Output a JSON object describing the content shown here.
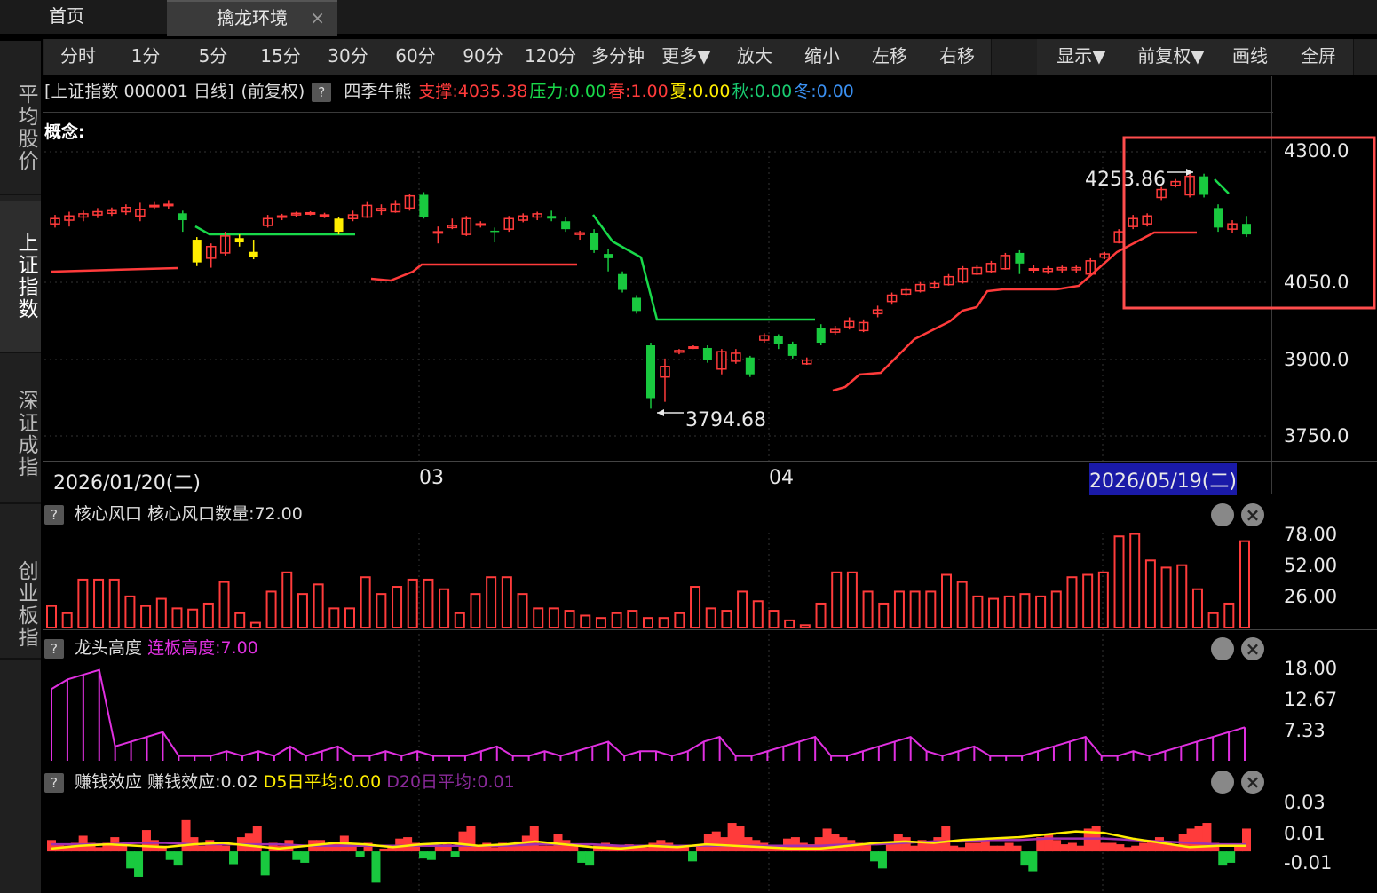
{
  "tabs": {
    "home": "首页",
    "active": "擒龙环境",
    "close": "×"
  },
  "leftnav": [
    "平均股价",
    "上证指数",
    "深证成指",
    "创业板指"
  ],
  "toolbar": [
    "分时",
    "1分",
    "5分",
    "15分",
    "30分",
    "60分",
    "90分",
    "120分",
    "多分钟",
    "更多▼",
    "放大",
    "缩小",
    "左移",
    "右移",
    "显示▼",
    "前复权▼",
    "画线",
    "全屏"
  ],
  "info": {
    "title": "[上证指数 000001 日线]",
    "adjust": "(前复权)",
    "help": "?",
    "indicator": "四季牛熊",
    "support": "支撑:4035.38",
    "pressure": "压力:0.00",
    "spring": "春:1.00",
    "summer": "夏:0.00",
    "autumn": "秋:0.00",
    "winter": "冬:0.00",
    "concept": "概念:"
  },
  "colors": {
    "up": "#ff3b3b",
    "down": "#19c93f",
    "yellow": "#ffee00",
    "magenta": "#e030e0",
    "purple": "#a030b0",
    "highlight": "#ff4d4d"
  },
  "chart_data": [
    {
      "type": "candlestick",
      "title": "上证指数 000001 日线",
      "x_labels": [
        "2026/01/20(二)",
        "03",
        "04",
        "2026/05/19(二)"
      ],
      "y_ticks": [
        "4300.0",
        "4050.0",
        "3900.0",
        "3750.0"
      ],
      "ylim": [
        3730,
        4310
      ],
      "annotations": {
        "high": "4253.86",
        "low": "3794.68"
      },
      "candles": [
        {
          "o": 4155,
          "c": 4165,
          "h": 4172,
          "l": 4148
        },
        {
          "o": 4162,
          "c": 4170,
          "h": 4178,
          "l": 4150
        },
        {
          "o": 4168,
          "c": 4174,
          "h": 4180,
          "l": 4160
        },
        {
          "o": 4172,
          "c": 4178,
          "h": 4185,
          "l": 4166
        },
        {
          "o": 4175,
          "c": 4180,
          "h": 4186,
          "l": 4170
        },
        {
          "o": 4178,
          "c": 4186,
          "h": 4192,
          "l": 4172
        },
        {
          "o": 4170,
          "c": 4182,
          "h": 4195,
          "l": 4160
        },
        {
          "o": 4188,
          "c": 4190,
          "h": 4198,
          "l": 4182
        },
        {
          "o": 4190,
          "c": 4192,
          "h": 4200,
          "l": 4184
        },
        {
          "o": 4175,
          "c": 4162,
          "h": 4180,
          "l": 4140
        },
        {
          "o": 4125,
          "c": 4082,
          "h": 4130,
          "l": 4075
        },
        {
          "o": 4090,
          "c": 4112,
          "h": 4118,
          "l": 4072
        },
        {
          "o": 4100,
          "c": 4132,
          "h": 4140,
          "l": 4095
        },
        {
          "o": 4128,
          "c": 4120,
          "h": 4135,
          "l": 4112
        },
        {
          "o": 4102,
          "c": 4092,
          "h": 4125,
          "l": 4088
        },
        {
          "o": 4152,
          "c": 4165,
          "h": 4172,
          "l": 4148
        },
        {
          "o": 4168,
          "c": 4170,
          "h": 4174,
          "l": 4162
        },
        {
          "o": 4172,
          "c": 4175,
          "h": 4178,
          "l": 4168
        },
        {
          "o": 4175,
          "c": 4176,
          "h": 4179,
          "l": 4171
        },
        {
          "o": 4170,
          "c": 4172,
          "h": 4176,
          "l": 4166
        },
        {
          "o": 4165,
          "c": 4140,
          "h": 4168,
          "l": 4135
        },
        {
          "o": 4165,
          "c": 4172,
          "h": 4180,
          "l": 4160
        },
        {
          "o": 4168,
          "c": 4190,
          "h": 4198,
          "l": 4166
        },
        {
          "o": 4180,
          "c": 4184,
          "h": 4192,
          "l": 4172
        },
        {
          "o": 4178,
          "c": 4192,
          "h": 4200,
          "l": 4176
        },
        {
          "o": 4185,
          "c": 4208,
          "h": 4212,
          "l": 4180
        },
        {
          "o": 4210,
          "c": 4168,
          "h": 4215,
          "l": 4165
        },
        {
          "o": 4138,
          "c": 4140,
          "h": 4150,
          "l": 4118
        },
        {
          "o": 4148,
          "c": 4152,
          "h": 4165,
          "l": 4145
        },
        {
          "o": 4135,
          "c": 4165,
          "h": 4170,
          "l": 4132
        },
        {
          "o": 4155,
          "c": 4155,
          "h": 4160,
          "l": 4148
        },
        {
          "o": 4142,
          "c": 4140,
          "h": 4148,
          "l": 4120
        },
        {
          "o": 4145,
          "c": 4165,
          "h": 4170,
          "l": 4140
        },
        {
          "o": 4162,
          "c": 4170,
          "h": 4175,
          "l": 4158
        },
        {
          "o": 4168,
          "c": 4174,
          "h": 4178,
          "l": 4162
        },
        {
          "o": 4170,
          "c": 4165,
          "h": 4180,
          "l": 4160
        },
        {
          "o": 4160,
          "c": 4145,
          "h": 4168,
          "l": 4140
        },
        {
          "o": 4135,
          "c": 4138,
          "h": 4142,
          "l": 4125
        },
        {
          "o": 4138,
          "c": 4105,
          "h": 4145,
          "l": 4100
        },
        {
          "o": 4098,
          "c": 4090,
          "h": 4108,
          "l": 4065
        },
        {
          "o": 4060,
          "c": 4030,
          "h": 4065,
          "l": 4025
        },
        {
          "o": 4015,
          "c": 3990,
          "h": 4020,
          "l": 3985
        },
        {
          "o": 3925,
          "c": 3825,
          "h": 3930,
          "l": 3805
        },
        {
          "o": 3865,
          "c": 3885,
          "h": 3900,
          "l": 3818
        },
        {
          "o": 3912,
          "c": 3915,
          "h": 3918,
          "l": 3908
        },
        {
          "o": 3922,
          "c": 3922,
          "h": 3925,
          "l": 3918
        },
        {
          "o": 3920,
          "c": 3897,
          "h": 3925,
          "l": 3892
        },
        {
          "o": 3880,
          "c": 3913,
          "h": 3918,
          "l": 3870
        },
        {
          "o": 3895,
          "c": 3910,
          "h": 3918,
          "l": 3890
        },
        {
          "o": 3902,
          "c": 3870,
          "h": 3905,
          "l": 3865
        },
        {
          "o": 3935,
          "c": 3943,
          "h": 3948,
          "l": 3930
        },
        {
          "o": 3942,
          "c": 3928,
          "h": 3946,
          "l": 3918
        },
        {
          "o": 3928,
          "c": 3905,
          "h": 3932,
          "l": 3900
        },
        {
          "o": 3890,
          "c": 3897,
          "h": 3902,
          "l": 3888
        },
        {
          "o": 3957,
          "c": 3930,
          "h": 3965,
          "l": 3925
        },
        {
          "o": 3950,
          "c": 3955,
          "h": 3962,
          "l": 3945
        },
        {
          "o": 3960,
          "c": 3970,
          "h": 3978,
          "l": 3955
        },
        {
          "o": 3953,
          "c": 3968,
          "h": 3974,
          "l": 3950
        },
        {
          "o": 3985,
          "c": 3992,
          "h": 4000,
          "l": 3978
        },
        {
          "o": 4008,
          "c": 4020,
          "h": 4025,
          "l": 4002
        },
        {
          "o": 4022,
          "c": 4030,
          "h": 4035,
          "l": 4018
        },
        {
          "o": 4028,
          "c": 4040,
          "h": 4045,
          "l": 4025
        },
        {
          "o": 4035,
          "c": 4042,
          "h": 4048,
          "l": 4032
        },
        {
          "o": 4040,
          "c": 4055,
          "h": 4060,
          "l": 4038
        },
        {
          "o": 4045,
          "c": 4070,
          "h": 4075,
          "l": 4042
        },
        {
          "o": 4060,
          "c": 4072,
          "h": 4078,
          "l": 4058
        },
        {
          "o": 4065,
          "c": 4080,
          "h": 4085,
          "l": 4062
        },
        {
          "o": 4070,
          "c": 4095,
          "h": 4100,
          "l": 4068
        },
        {
          "o": 4100,
          "c": 4080,
          "h": 4105,
          "l": 4060
        },
        {
          "o": 4068,
          "c": 4070,
          "h": 4078,
          "l": 4062
        },
        {
          "o": 4065,
          "c": 4070,
          "h": 4075,
          "l": 4060
        },
        {
          "o": 4068,
          "c": 4072,
          "h": 4076,
          "l": 4062
        },
        {
          "o": 4068,
          "c": 4072,
          "h": 4076,
          "l": 4062
        },
        {
          "o": 4060,
          "c": 4085,
          "h": 4090,
          "l": 4058
        },
        {
          "o": 4092,
          "c": 4098,
          "h": 4102,
          "l": 4088
        },
        {
          "o": 4120,
          "c": 4140,
          "h": 4145,
          "l": 4118
        },
        {
          "o": 4150,
          "c": 4165,
          "h": 4172,
          "l": 4145
        },
        {
          "o": 4155,
          "c": 4170,
          "h": 4175,
          "l": 4150
        },
        {
          "o": 4205,
          "c": 4220,
          "h": 4225,
          "l": 4200
        },
        {
          "o": 4228,
          "c": 4235,
          "h": 4240,
          "l": 4224
        },
        {
          "o": 4210,
          "c": 4245,
          "h": 4253.86,
          "l": 4205
        },
        {
          "o": 4245,
          "c": 4210,
          "h": 4250,
          "l": 4205
        },
        {
          "o": 4185,
          "c": 4148,
          "h": 4192,
          "l": 4140
        },
        {
          "o": 4145,
          "c": 4155,
          "h": 4162,
          "l": 4138
        },
        {
          "o": 4155,
          "c": 4135,
          "h": 4170,
          "l": 4130
        }
      ],
      "down_yellow_idx": [
        10,
        11,
        12,
        13,
        14,
        20,
        37
      ]
    },
    {
      "type": "bar",
      "title": "核心风口",
      "label": "核心风口数量:72.00",
      "y_ticks": [
        "78.00",
        "52.00",
        "26.00"
      ],
      "ylim": [
        0,
        80
      ],
      "values": [
        18,
        12,
        40,
        40,
        40,
        26,
        18,
        24,
        16,
        15,
        20,
        38,
        12,
        4,
        30,
        46,
        28,
        36,
        16,
        16,
        42,
        28,
        34,
        40,
        40,
        32,
        12,
        28,
        42,
        42,
        28,
        16,
        16,
        14,
        10,
        8,
        12,
        14,
        8,
        8,
        12,
        34,
        16,
        14,
        30,
        22,
        14,
        6,
        2,
        20,
        46,
        46,
        30,
        20,
        30,
        30,
        30,
        44,
        38,
        26,
        24,
        26,
        28,
        26,
        30,
        42,
        44,
        46,
        76,
        78,
        56,
        50,
        52,
        32,
        12,
        20,
        72
      ]
    },
    {
      "type": "line",
      "title": "龙头高度",
      "label": "连板高度:7.00",
      "y_ticks": [
        "18.00",
        "12.67",
        "7.33"
      ],
      "ylim": [
        0,
        19.5
      ],
      "values": [
        15,
        17,
        18,
        19,
        3,
        4,
        5,
        6,
        1,
        1,
        1,
        2,
        1,
        2,
        1,
        3,
        1,
        2,
        3,
        1,
        1,
        2,
        1,
        2,
        1,
        1,
        1,
        2,
        3,
        1,
        1,
        2,
        1,
        2,
        3,
        4,
        1,
        2,
        2,
        1,
        2,
        4,
        5,
        1,
        1,
        2,
        3,
        4,
        5,
        1,
        1,
        2,
        3,
        4,
        5,
        2,
        1,
        2,
        3,
        1,
        1,
        1,
        2,
        3,
        4,
        5,
        1,
        1,
        2,
        1,
        2,
        3,
        4,
        5,
        6,
        7
      ]
    },
    {
      "type": "bar",
      "title": "赚钱效应",
      "label": "赚钱效应:0.02",
      "series_names": [
        "D5日平均:0.00",
        "D20日平均:0.01"
      ],
      "y_ticks": [
        "0.03",
        "0.01",
        "-0.01"
      ],
      "ylim": [
        -0.028,
        0.035
      ],
      "values": [
        0.008,
        0.005,
        0.004,
        0.006,
        0.011,
        0.006,
        0.003,
        0.006,
        0.01,
        0.006,
        -0.012,
        -0.018,
        0.015,
        0.008,
        0.004,
        -0.006,
        -0.01,
        0.022,
        0.01,
        0.004,
        0.008,
        0.006,
        0.004,
        -0.009,
        0.01,
        0.013,
        0.018,
        -0.017,
        0.006,
        0.004,
        0.008,
        -0.006,
        -0.008,
        0.008,
        0.008,
        0.006,
        0.006,
        0.011,
        0.006,
        -0.004,
        0.006,
        -0.022,
        0.002,
        0.004,
        0.009,
        0.01,
        0.006,
        -0.005,
        -0.006,
        0.004,
        0.005,
        -0.004,
        0.014,
        0.018,
        0.004,
        0.006,
        0.003,
        0.006,
        0.004,
        0.007,
        0.011,
        0.018,
        0.004,
        0.004,
        0.012,
        0.008,
        0.004,
        -0.008,
        -0.01,
        0.004,
        0.006,
        0.004,
        0.004,
        0.005,
        0.003,
        0.003,
        0.006,
        0.008,
        0.006,
        0.003,
        0.004,
        -0.007,
        0.004,
        0.012,
        0.014,
        0.01,
        0.02,
        0.018,
        0.01,
        0.008,
        0.006,
        0.004,
        0.004,
        0.009,
        0.01,
        0.006,
        0.005,
        0.01,
        0.016,
        0.012,
        0.01,
        0.008,
        0.006,
        0.005,
        -0.007,
        -0.012,
        0.006,
        0.012,
        0.01,
        0.004,
        0.008,
        0.006,
        0.01,
        0.018,
        0.004,
        0.003,
        0.006,
        0.006,
        0.008,
        0.004,
        0.004,
        0.006,
        0.004,
        -0.01,
        -0.014,
        0.01,
        0.012,
        0.008,
        0.005,
        0.006,
        0.004,
        0.016,
        0.018,
        0.006,
        0.006,
        0.005,
        0.003,
        0.004,
        0.006,
        0.008,
        0.01,
        0.006,
        0.005,
        0.012,
        0.016,
        0.018,
        0.02,
        0.006,
        -0.01,
        -0.008,
        0.004,
        0.016
      ],
      "d5": [
        0.002,
        0.004,
        0.005,
        0.004,
        0.003,
        0.005,
        0.006,
        0.004,
        0.002,
        0.004,
        0.006,
        0.005,
        0.003,
        0.005,
        0.006,
        0.004,
        0.005,
        0.007,
        0.005,
        0.003,
        0.002,
        0.004,
        0.003,
        0.005,
        0.004,
        0.003,
        0.002,
        0.002,
        0.004,
        0.006,
        0.007,
        0.006,
        0.008,
        0.009,
        0.01,
        0.012,
        0.014,
        0.013,
        0.009,
        0.006,
        0.003,
        0.004,
        0.004
      ],
      "d20": [
        0.005,
        0.005,
        0.005,
        0.006,
        0.006,
        0.005,
        0.005,
        0.005,
        0.005,
        0.004,
        0.004,
        0.004,
        0.004,
        0.004,
        0.004,
        0.004,
        0.004,
        0.005,
        0.005,
        0.005,
        0.004,
        0.004,
        0.004,
        0.004,
        0.004,
        0.004,
        0.004,
        0.004,
        0.005,
        0.005,
        0.006,
        0.007,
        0.007,
        0.008,
        0.008,
        0.009,
        0.009,
        0.009,
        0.008,
        0.007,
        0.006,
        0.005,
        0.005
      ]
    }
  ]
}
